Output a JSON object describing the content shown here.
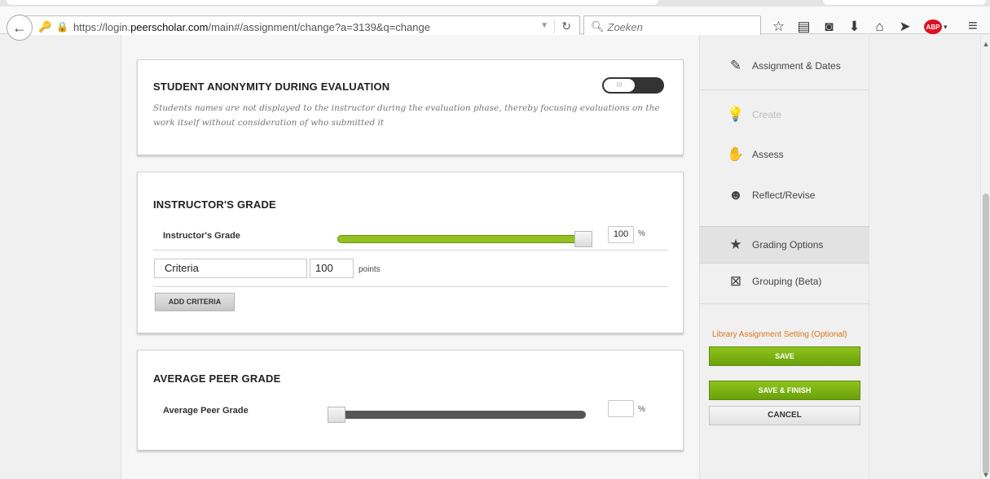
{
  "browser": {
    "url_prefix": "https://login.",
    "url_domain": "peerscholar.com",
    "url_path": "/main#/assignment/change?a=3139&q=change",
    "search_placeholder": "Zoeken"
  },
  "sections": {
    "anonymity": {
      "title": "STUDENT ANONYMITY DURING EVALUATION",
      "description": "Students names are not displayed to the instructor during the evaluation phase, thereby focusing evaluations on the work itself without consideration of who submitted it",
      "toggle_knob": "III"
    },
    "instructor": {
      "title": "INSTRUCTOR'S GRADE",
      "row_label": "Instructor's Grade",
      "percent": "100",
      "percent_sign": "%",
      "slider_value": 1.0,
      "criteria_name": "Criteria",
      "criteria_points": "100",
      "points_label": "points",
      "add_button": "ADD CRITERIA"
    },
    "peer": {
      "title": "AVERAGE PEER GRADE",
      "row_label": "Average Peer Grade",
      "percent": "",
      "percent_sign": "%",
      "slider_value": 0.0
    }
  },
  "sidebar": {
    "items": [
      {
        "label": "Assignment & Dates",
        "icon": "edit-icon"
      },
      {
        "label": "Create",
        "icon": "lightbulb-icon",
        "disabled": true
      },
      {
        "label": "Assess",
        "icon": "hands-icon"
      },
      {
        "label": "Reflect/Revise",
        "icon": "head-icon"
      },
      {
        "label": "Grading Options",
        "icon": "star-icon",
        "active": true
      },
      {
        "label": "Grouping (Beta)",
        "icon": "grouping-icon"
      }
    ],
    "library_setting": "Library Assignment Setting (Optional)",
    "save": "SAVE",
    "save_finish": "SAVE & FINISH",
    "cancel": "CANCEL"
  },
  "colors": {
    "accent_green": "#8fc31c",
    "library_orange": "#d9751b",
    "slider_fill": "#94c11f"
  }
}
